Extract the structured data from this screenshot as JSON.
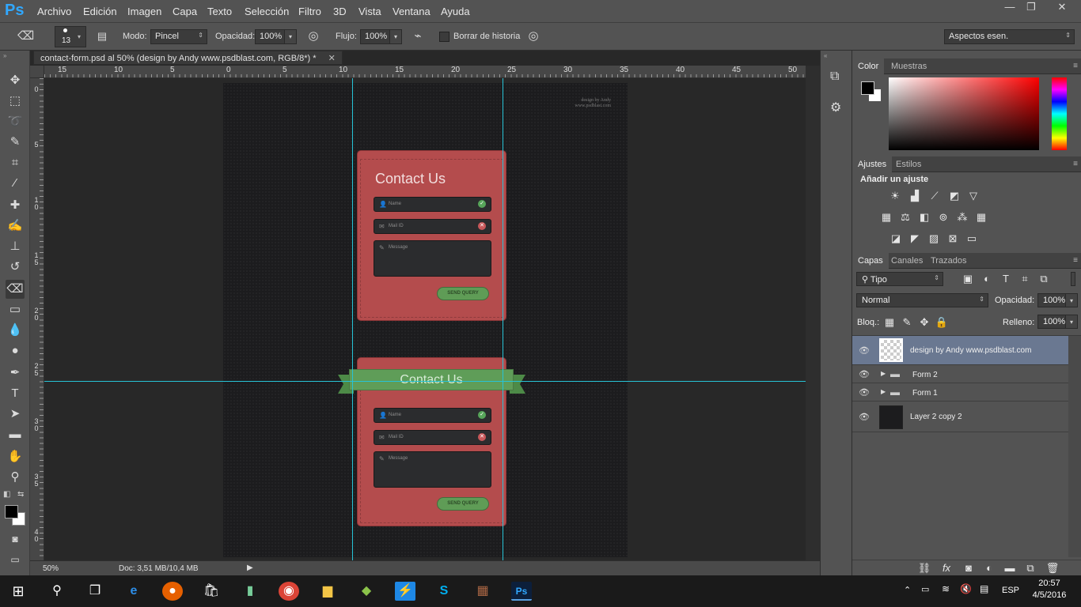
{
  "app": {
    "logo": "Ps"
  },
  "menu": [
    "Archivo",
    "Edición",
    "Imagen",
    "Capa",
    "Texto",
    "Selección",
    "Filtro",
    "3D",
    "Vista",
    "Ventana",
    "Ayuda"
  ],
  "window_controls": {
    "minimize": "—",
    "restore": "❐",
    "close": "✕"
  },
  "options": {
    "brush_size": "13",
    "mode_label": "Modo:",
    "mode_value": "Pincel",
    "opacity_label": "Opacidad:",
    "opacity_value": "100%",
    "flow_label": "Flujo:",
    "flow_value": "100%",
    "erase_history_label": "Borrar de historia",
    "workspace": "Aspectos esen."
  },
  "document": {
    "tab_title": "contact-form.psd al 50% (design by Andy www.psdblast.com, RGB/8*) *",
    "tab_close": "✕",
    "zoom": "50%",
    "doc_info": "Doc: 3,51 MB/10,4 MB"
  },
  "ruler_h": [
    "15",
    "10",
    "5",
    "0",
    "5",
    "10",
    "15",
    "20",
    "25",
    "30",
    "35",
    "40",
    "45",
    "50"
  ],
  "ruler_v": [
    "0",
    "5",
    "1 0",
    "1 5",
    "2 0",
    "2 5",
    "3 0",
    "3 5",
    "4 0"
  ],
  "artwork": {
    "watermark_line1": "design by Andy",
    "watermark_line2": "www.psdblast.com",
    "form1": {
      "title": "Contact Us",
      "name_placeholder": "Name",
      "mail_placeholder": "Mail ID",
      "message_placeholder": "Message",
      "button": "SEND QUERY"
    },
    "form2": {
      "ribbon_title": "Contact Us",
      "name_placeholder": "Name",
      "mail_placeholder": "Mail ID",
      "message_placeholder": "Message",
      "button": "SEND QUERY"
    }
  },
  "panels": {
    "color_tabs": [
      "Color",
      "Muestras"
    ],
    "adjust_tabs": [
      "Ajustes",
      "Estilos"
    ],
    "add_adjustment": "Añadir un ajuste",
    "layers_tabs": [
      "Capas",
      "Canales",
      "Trazados"
    ],
    "filter_kind": "Tipo",
    "blend_mode": "Normal",
    "opacity_label": "Opacidad:",
    "opacity_value": "100%",
    "lock_label": "Bloq.:",
    "fill_label": "Relleno:",
    "fill_value": "100%",
    "layers": [
      {
        "name": "design by Andy www.psdblast.com",
        "kind": "text",
        "selected": true
      },
      {
        "name": "Form 2",
        "kind": "group",
        "selected": false
      },
      {
        "name": "Form 1",
        "kind": "group",
        "selected": false
      },
      {
        "name": "Layer 2 copy 2",
        "kind": "pixel",
        "selected": false
      }
    ]
  },
  "taskbar": {
    "time": "20:57",
    "date": "4/5/2016",
    "lang": "ESP"
  },
  "colors": {
    "card_red": "#b44c4d",
    "ribbon_green": "#5f9d58",
    "guide_cyan": "#27c3d6",
    "selected_layer": "#6a7891"
  }
}
